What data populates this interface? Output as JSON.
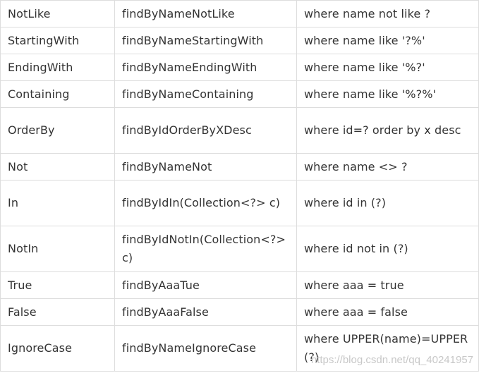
{
  "table": {
    "rows": [
      {
        "keyword": "NotLike",
        "method": "findByNameNotLike",
        "sql": "where name not like ?"
      },
      {
        "keyword": "StartingWith",
        "method": "findByNameStartingWith",
        "sql": "where name like '?%'"
      },
      {
        "keyword": "EndingWith",
        "method": "findByNameEndingWith",
        "sql": "where name like '%?'"
      },
      {
        "keyword": "Containing",
        "method": "findByNameContaining",
        "sql": "where name like '%?%'"
      },
      {
        "keyword": "OrderBy",
        "method": "findByIdOrderByXDesc",
        "sql": "where id=? order by x desc"
      },
      {
        "keyword": "Not",
        "method": "findByNameNot",
        "sql": "where name <> ?"
      },
      {
        "keyword": "In",
        "method": "findByIdIn(Collection<?> c)",
        "sql": "where id in (?)"
      },
      {
        "keyword": "NotIn",
        "method": "findByIdNotIn(Collection<?> c)",
        "sql": "where id not in (?)"
      },
      {
        "keyword": "True",
        "method": "findByAaaTue",
        "sql": "where aaa = true"
      },
      {
        "keyword": "False",
        "method": "findByAaaFalse",
        "sql": "where aaa = false"
      },
      {
        "keyword": "IgnoreCase",
        "method": "findByNameIgnoreCase",
        "sql": "where UPPER(name)=UPPER(?)"
      }
    ]
  },
  "watermark": "https://blog.csdn.net/qq_40241957",
  "colors": {
    "text": "#333333",
    "border": "#dddddd",
    "watermark": "#c8c8c8"
  }
}
